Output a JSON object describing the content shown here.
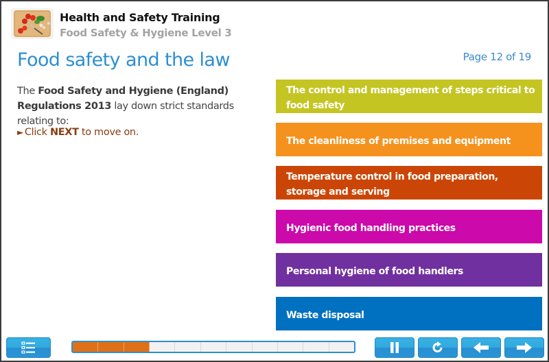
{
  "header": {
    "app_title": "Health and Safety Training",
    "course_title": "Food Safety & Hygiene Level 3",
    "logo_icon": "cutting-board-with-vegetables-image"
  },
  "page": {
    "title": "Food safety and the law",
    "counter": "Page 12 of 19",
    "current_page": 12,
    "total_pages": 19
  },
  "intro": {
    "prefix": "The ",
    "bold_regulation": "Food Safety and Hygiene (England) Regulations 2013",
    "suffix": " lay down strict standards relating to:"
  },
  "instruction": {
    "arrow_icon": "►",
    "prefix": "Click ",
    "bold": "NEXT",
    "suffix": " to move on.",
    "color": "#8a3d10"
  },
  "standards": [
    {
      "label": "The control and management of steps critical to food safety",
      "color": "#c4c522"
    },
    {
      "label": "The cleanliness of premises and equipment",
      "color": "#f5921e"
    },
    {
      "label": "Temperature control in food preparation, storage and serving",
      "color": "#cb4606"
    },
    {
      "label": "Hygienic food handling practices",
      "color": "#cc09aa"
    },
    {
      "label": "Personal hygiene of food handlers",
      "color": "#7030a0"
    },
    {
      "label": "Waste disposal",
      "color": "#0070c0"
    }
  ],
  "controls": {
    "menu_button": {
      "icon": "menu-list-icon",
      "label": "Menu"
    },
    "pause_button": {
      "icon": "pause-icon",
      "label": "Pause"
    },
    "replay_button": {
      "icon": "replay-icon",
      "label": "Replay"
    },
    "back_button": {
      "icon": "arrow-left-icon",
      "label": "Back"
    },
    "next_button": {
      "icon": "arrow-right-icon",
      "label": "Next"
    }
  },
  "progress": {
    "segments_total": 11,
    "segments_filled": 3,
    "fill_color": "#e07018"
  },
  "colors": {
    "accent_blue": "#2b8fd0",
    "button_blue": "#33a9df"
  }
}
